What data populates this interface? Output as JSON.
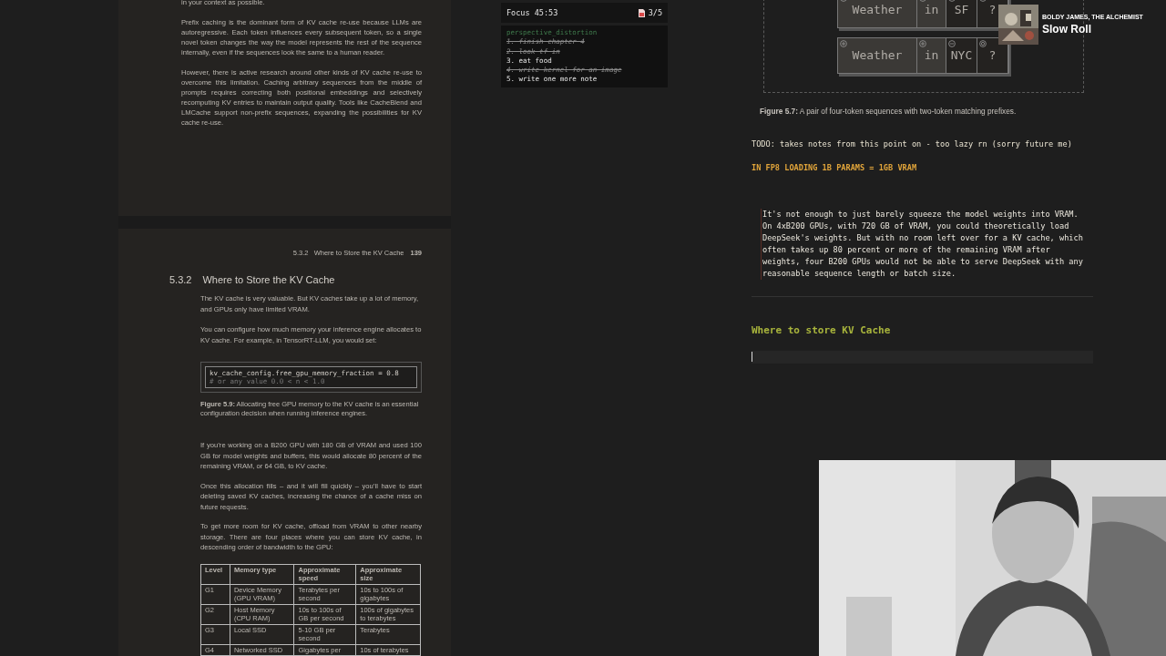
{
  "pdf": {
    "top_page": {
      "paragraphs": [
        "in your context as possible.",
        "Prefix caching is the dominant form of KV cache re-use because LLMs are autoregressive. Each token influences every subsequent token, so a single novel token changes the way the model represents the rest of the sequence internally, even if the sequences look the same to a human reader.",
        "However, there is active research around other kinds of KV cache re-use to overcome this limitation. Caching arbitrary sequences from the middle of prompts requires correcting both positional embeddings and selectively recomputing KV entries to maintain output quality. Tools like CacheBlend and LMCache support non-prefix sequences, expanding the possibilities for KV cache re-use."
      ]
    },
    "page": {
      "running_header": {
        "section": "5.3.2",
        "title": "Where to Store the KV Cache",
        "page_number": "139"
      },
      "heading": {
        "number": "5.3.2",
        "title": "Where to Store the KV Cache"
      },
      "paragraphs_before_figure": [
        "The KV cache is very valuable. But KV caches take up a lot of memory, and GPUs only have limited VRAM.",
        "You can configure how much memory your inference engine allocates to KV cache. For example, in TensorRT-LLM, you would set:"
      ],
      "figure": {
        "code": [
          "kv_cache_config.free_gpu_memory_fraction = 0.8",
          "# or any value 0.0 < n < 1.0"
        ],
        "caption": "**Figure 5.9:** Allocating free GPU memory to the KV cache is an essential configuration decision when running inference engines."
      },
      "paragraphs_after_figure": [
        "If you’re working on a B200 GPU with 180 GB of VRAM and used 100 GB for model weights and buffers, this would allocate 80 percent of the remaining VRAM, or 64 GB, to KV cache.",
        "Once this allocation fills – and it will fill quickly – you’ll have to start deleting saved KV caches, increasing the chance of a cache miss on future requests.",
        "To get more room for KV cache, offload from VRAM to other nearby storage. There are four places where you can store KV cache, in descending order of bandwidth to the GPU:"
      ],
      "table": {
        "columns": [
          "Level",
          "Memory type",
          "Approximate speed",
          "Approximate size"
        ],
        "rows": [
          [
            "G1",
            "Device Memory (GPU VRAM)",
            "Terabytes per second",
            "10s to 100s of gigabytes"
          ],
          [
            "G2",
            "Host Memory (CPU RAM)",
            "10s to 100s of GB per second",
            "100s of gigabytes to terabytes"
          ],
          [
            "G3",
            "Local SSD",
            "5-10 GB per second",
            "Terabytes"
          ],
          [
            "G4",
            "Networked SSD",
            "Gigabytes per",
            "10s of terabytes"
          ]
        ]
      }
    }
  },
  "focus": {
    "title": "Focus 45:53",
    "count": "3/5",
    "list_title": "perspective_distortion",
    "tasks": [
      {
        "text": "1. finish chapter 4",
        "done": true
      },
      {
        "text": "2. look tf in",
        "done": true
      },
      {
        "text": "3. eat food",
        "done": false
      },
      {
        "text": "4. write kernel for an image",
        "done": true
      },
      {
        "text": "5. write one more note",
        "done": false
      }
    ]
  },
  "notes": {
    "figure": {
      "rows": [
        {
          "tokens": [
            {
              "text": "Weather",
              "matched": true,
              "kind": "plus"
            },
            {
              "text": "in",
              "matched": true,
              "kind": "plus"
            },
            {
              "text": "SF",
              "matched": false,
              "kind": "minus"
            },
            {
              "text": "?",
              "matched": false,
              "kind": "ring"
            }
          ]
        },
        {
          "tokens": [
            {
              "text": "Weather",
              "matched": true,
              "kind": "plus"
            },
            {
              "text": "in",
              "matched": true,
              "kind": "plus"
            },
            {
              "text": "NYC",
              "matched": false,
              "kind": "minus"
            },
            {
              "text": "?",
              "matched": false,
              "kind": "ring"
            }
          ]
        }
      ],
      "caption": "**Figure 5.7:** A pair of four-token sequences with two-token matching prefixes."
    },
    "todo": "TODO: takes notes from this point on - too lazy rn (sorry future me)",
    "highlight": "IN FP8 LOADING 1B PARAMS = 1GB VRAM",
    "quote": "It's not enough to just barely squeeze the model weights into VRAM. On 4xB200 GPUs, with 720 GB of VRAM, you could theoretically load DeepSeek's weights. But with no room left over for a KV cache, which often takes up 80 percent or more of the remaining VRAM after weights, four B200 GPUs would not be able to serve DeepSeek with any reasonable sequence length or batch size.",
    "heading": "Where to store KV Cache"
  },
  "now_playing": {
    "artist": "BOLDY JAMES, THE ALCHEMIST",
    "title": "Slow Roll"
  }
}
